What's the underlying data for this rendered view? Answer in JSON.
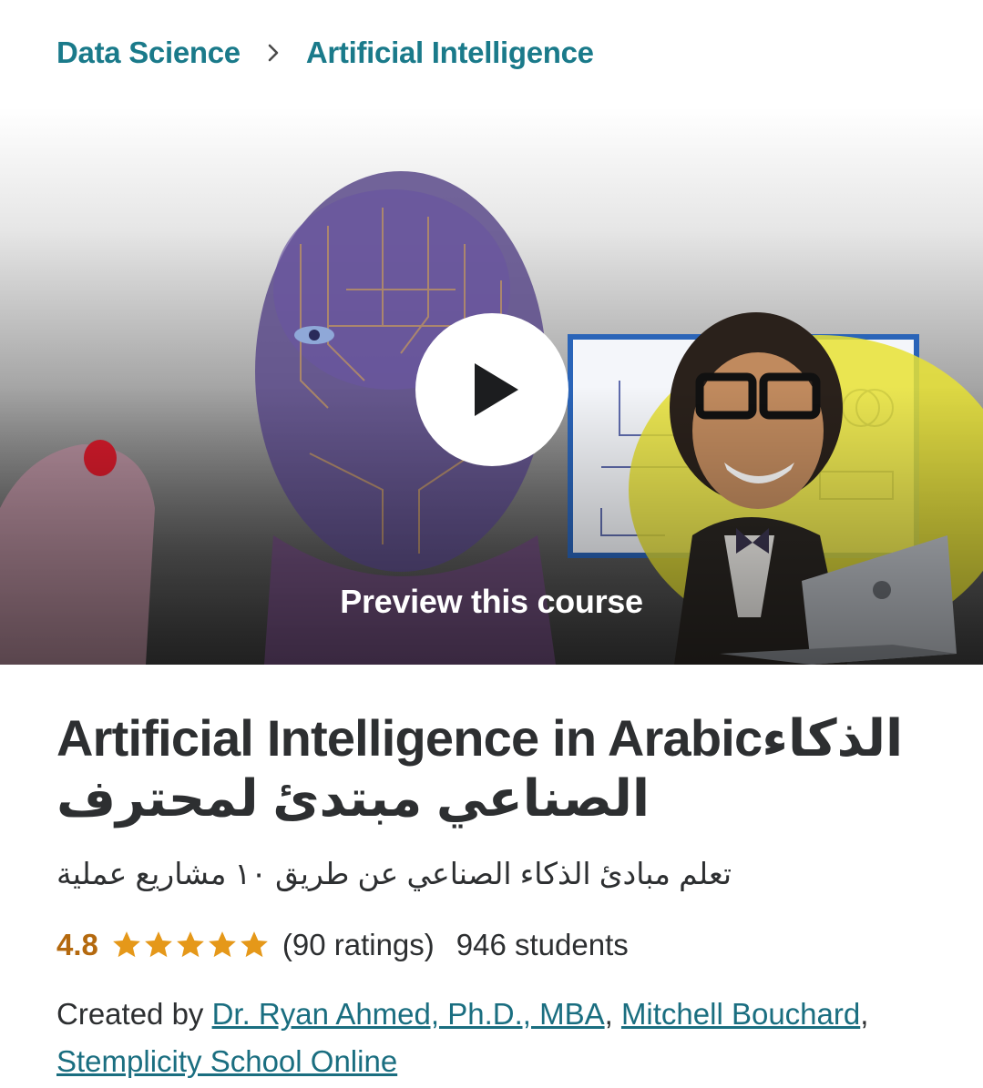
{
  "breadcrumb": {
    "items": [
      "Data Science",
      "Artificial Intelligence"
    ]
  },
  "hero": {
    "preview_label": "Preview this course",
    "icons": [
      "play-icon",
      "chevron-right-icon"
    ]
  },
  "course": {
    "title_en": "Artificial Intelligence in Arabic",
    "title_ar": "الذكاء الصناعي مبتدئ لمحترف",
    "subtitle": "تعلم مبادئ الذكاء الصناعي عن طريق ١٠ مشاريع عملية",
    "rating": "4.8",
    "stars": 5,
    "ratings_count": "(90 ratings)",
    "students": "946 students",
    "created_by_label": "Created by",
    "instructors": [
      "Dr. Ryan Ahmed, Ph.D., MBA",
      "Mitchell Bouchard",
      "Stemplicity School Online"
    ]
  },
  "colors": {
    "link": "#1a7a8a",
    "rating": "#b4690e",
    "star": "#e59819"
  }
}
